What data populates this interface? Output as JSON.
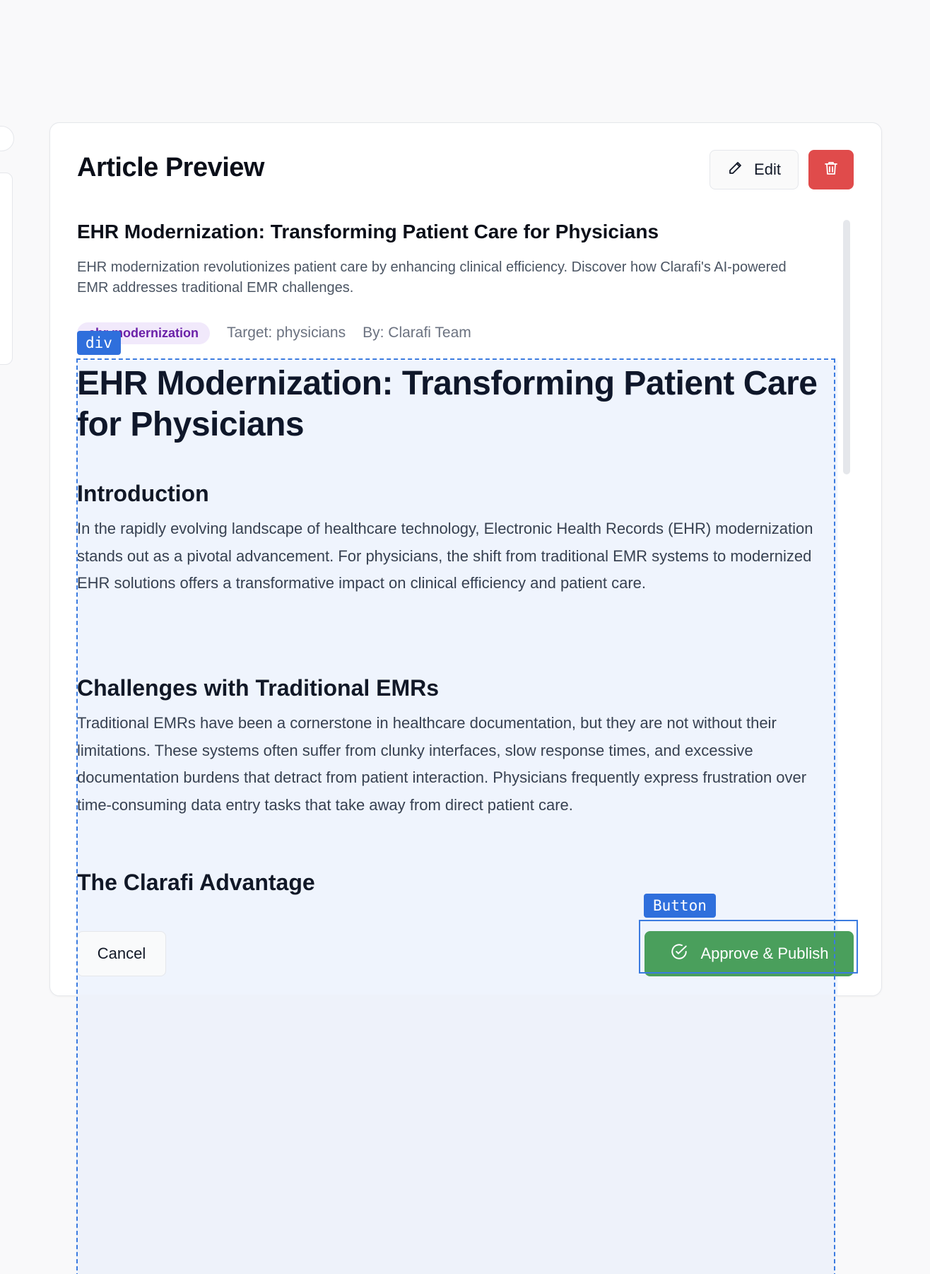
{
  "card": {
    "title": "Article Preview",
    "edit_label": "Edit"
  },
  "article": {
    "title": "EHR Modernization: Transforming Patient Care for Physicians",
    "summary": "EHR modernization revolutionizes patient care by enhancing clinical efficiency. Discover how Clarafi's AI-powered EMR addresses traditional EMR challenges.",
    "tag": "ehr modernization",
    "target": "Target: physicians",
    "author": "By: Clarafi Team",
    "heading": "EHR Modernization: Transforming Patient Care for Physicians",
    "sections": [
      {
        "heading": "Introduction",
        "body": "In the rapidly evolving landscape of healthcare technology, Electronic Health Records (EHR) modernization stands out as a pivotal advancement. For physicians, the shift from traditional EMR systems to modernized EHR solutions offers a transformative impact on clinical efficiency and patient care."
      },
      {
        "heading": "Challenges with Traditional EMRs",
        "body": "Traditional EMRs have been a cornerstone in healthcare documentation, but they are not without their limitations. These systems often suffer from clunky interfaces, slow response times, and excessive documentation burdens that detract from patient interaction. Physicians frequently express frustration over time-consuming data entry tasks that take away from direct patient care."
      },
      {
        "heading": "The Clarafi Advantage"
      }
    ]
  },
  "footer": {
    "cancel_label": "Cancel",
    "approve_label": "Approve & Publish"
  },
  "inspector": {
    "div_label": "div",
    "button_label": "Button"
  },
  "icons": {
    "edit": "pencil-icon",
    "delete": "trash-icon",
    "approve": "check-circle-icon"
  },
  "colors": {
    "delete_button": "#e04b4b",
    "approve_button": "#4a9f5c",
    "tag_bg": "#f1e9fb",
    "tag_text": "#6b21a8",
    "inspector": "#2f6fdc"
  }
}
